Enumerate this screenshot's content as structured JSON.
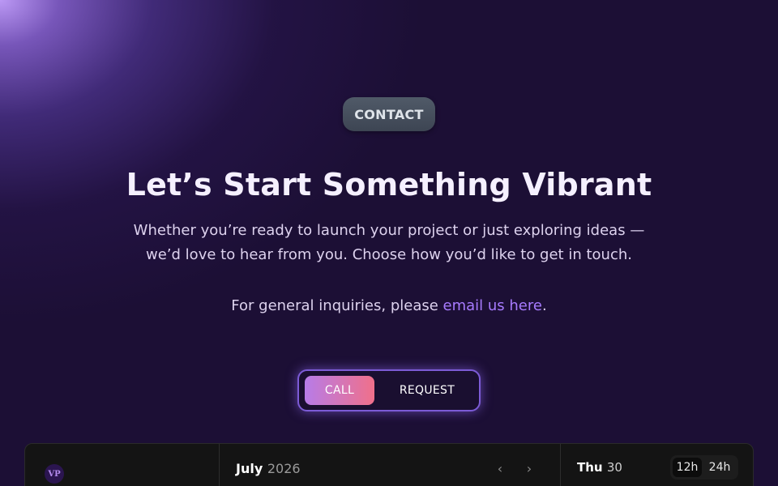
{
  "badge": {
    "label": "CONTACT"
  },
  "hero": {
    "title": "Let’s Start Something Vibrant",
    "subtitle": "Whether you’re ready to launch your project or just exploring ideas — we’d love to hear from you. Choose how you’d like to get in touch."
  },
  "inquiry": {
    "prefix": "For general inquiries, please ",
    "link_text": "email us here",
    "suffix": "."
  },
  "toggle": {
    "options": [
      "CALL",
      "REQUEST"
    ],
    "selected": "CALL"
  },
  "booking": {
    "avatar_initials": "VP",
    "month": "July",
    "year": "2026",
    "prev_icon": "‹",
    "next_icon": "›",
    "day_name": "Thu",
    "day_number": "30",
    "time_formats": [
      "12h",
      "24h"
    ],
    "selected_format": "12h"
  },
  "colors": {
    "background": "#1c0f35",
    "accent_link": "#a77bff",
    "call_gradient_start": "#b77ce8",
    "call_gradient_end": "#f0708a"
  }
}
